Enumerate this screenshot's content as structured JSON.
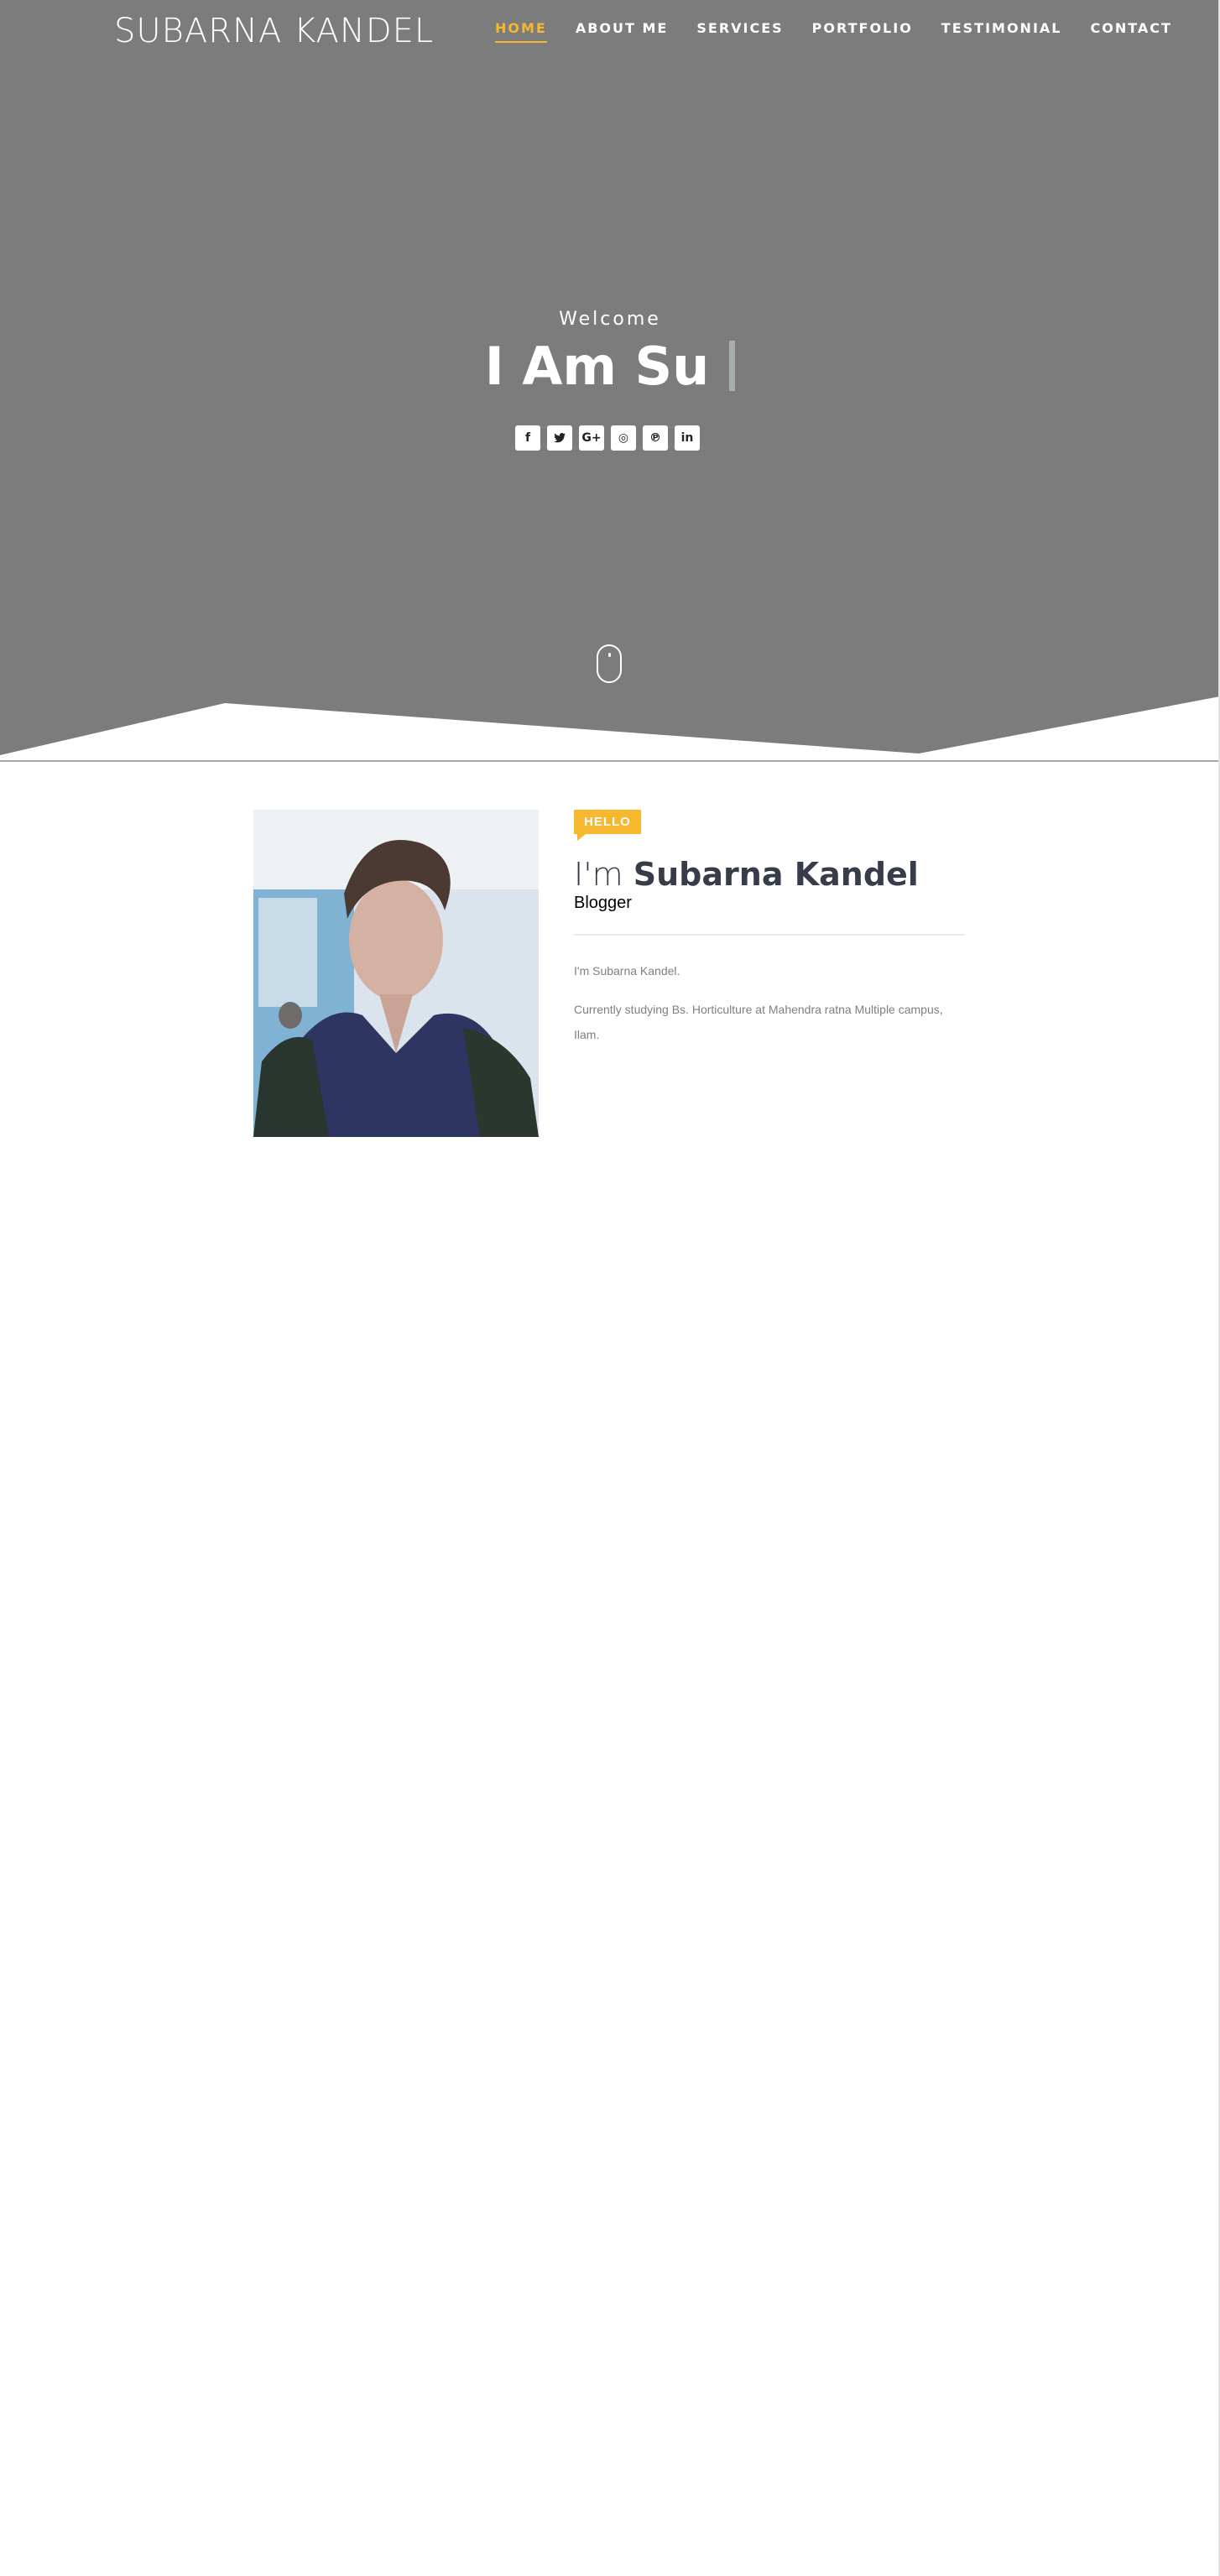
{
  "header": {
    "brand": "SUBARNA KANDEL",
    "nav": [
      {
        "label": "HOME",
        "active": true
      },
      {
        "label": "ABOUT ME",
        "active": false
      },
      {
        "label": "SERVICES",
        "active": false
      },
      {
        "label": "PORTFOLIO",
        "active": false
      },
      {
        "label": "TESTIMONIAL",
        "active": false
      },
      {
        "label": "CONTACT",
        "active": false
      }
    ]
  },
  "hero": {
    "welcome": "Welcome",
    "headline": "I Am Su",
    "socials": [
      {
        "icon": "facebook-icon",
        "glyph": "f"
      },
      {
        "icon": "twitter-icon",
        "glyph": "🐦"
      },
      {
        "icon": "google-plus-icon",
        "glyph": "G+"
      },
      {
        "icon": "instagram-icon",
        "glyph": "◎"
      },
      {
        "icon": "pinterest-icon",
        "glyph": "℗"
      },
      {
        "icon": "linkedin-icon",
        "glyph": "in"
      }
    ]
  },
  "about": {
    "badge": "HELLO",
    "title_prefix": "I'm",
    "title_name": "Subarna Kandel",
    "role": "Blogger",
    "paragraphs": [
      "I'm Subarna Kandel.",
      "Currently studying Bs. Horticulture at Mahendra ratna Multiple campus, Ilam."
    ]
  },
  "colors": {
    "hero_bg": "#7c7c7c",
    "accent": "#f5b82e",
    "heading": "#363c4a",
    "body_text": "#7f7f7f"
  }
}
